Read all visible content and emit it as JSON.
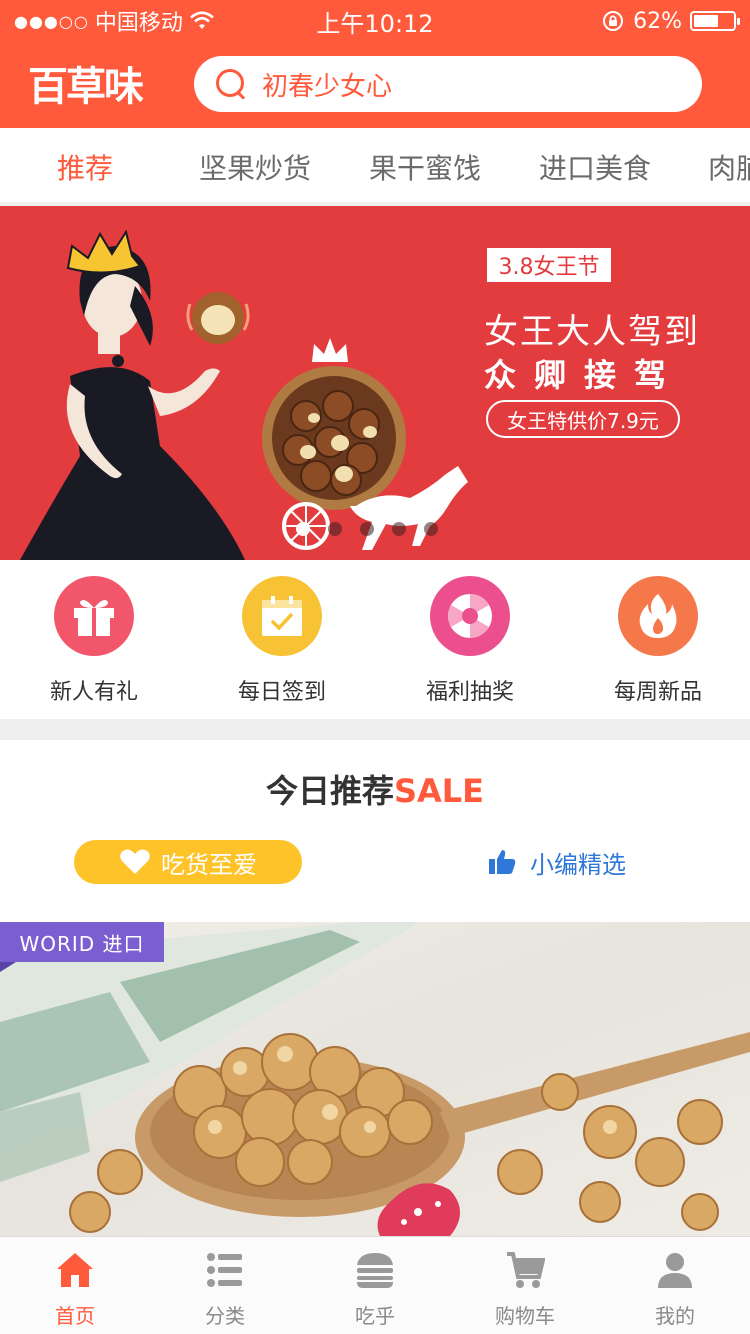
{
  "status_bar": {
    "signal_dots": "●●●○○",
    "carrier": "中国移动",
    "time": "上午10:12",
    "battery_percent_label": "62%",
    "battery_level": 0.62
  },
  "header": {
    "logo_text": "百草味",
    "search_placeholder": "初春少女心"
  },
  "category_tabs": [
    {
      "label": "推荐",
      "active": true
    },
    {
      "label": "坚果炒货",
      "active": false
    },
    {
      "label": "果干蜜饯",
      "active": false
    },
    {
      "label": "进口美食",
      "active": false
    },
    {
      "label": "肉脯",
      "active": false
    }
  ],
  "banner": {
    "tag": "3.8女王节",
    "headline_1": "女王大人驾到",
    "headline_2": "众卿接驾",
    "price_pill": "女王特供价7.9元",
    "carousel_count": 5,
    "carousel_active_index": 0
  },
  "quick_entries": [
    {
      "label": "新人有礼",
      "icon": "gift-icon",
      "color": "#f2566a"
    },
    {
      "label": "每日签到",
      "icon": "calendar-check-icon",
      "color": "#f7c233"
    },
    {
      "label": "福利抽奖",
      "icon": "lottery-wheel-icon",
      "color": "#ec4f8e"
    },
    {
      "label": "每周新品",
      "icon": "flame-icon",
      "color": "#f5784a"
    }
  ],
  "recommend": {
    "title_main": "今日推荐",
    "title_sale": "SALE",
    "chip_left": "吃货至爱",
    "chip_right": "小编精选"
  },
  "product": {
    "badge": "WORID 进口"
  },
  "tab_bar": [
    {
      "label": "首页",
      "icon": "home-icon",
      "active": true
    },
    {
      "label": "分类",
      "icon": "list-icon",
      "active": false
    },
    {
      "label": "吃乎",
      "icon": "burger-icon",
      "active": false
    },
    {
      "label": "购物车",
      "icon": "cart-icon",
      "active": false
    },
    {
      "label": "我的",
      "icon": "user-icon",
      "active": false
    }
  ],
  "colors": {
    "brand": "#ff5a3b",
    "banner_bg": "#e23c3e",
    "badge_purple": "#7b5fd0",
    "chip_yellow": "#ffc32a",
    "editor_blue": "#2f77d8"
  }
}
